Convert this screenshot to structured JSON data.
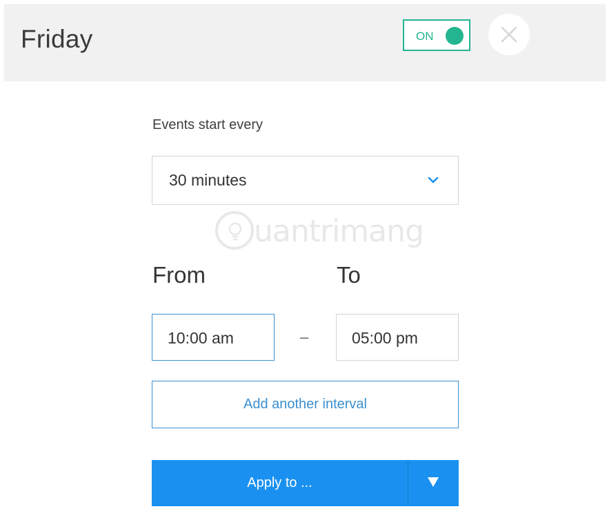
{
  "header": {
    "title": "Friday",
    "toggle": {
      "label": "ON",
      "state": "on",
      "color": "#23b58f"
    },
    "close_icon": "close-icon"
  },
  "schedule": {
    "events_label": "Events start every",
    "interval": {
      "value": "30 minutes",
      "icon": "chevron-down-icon"
    },
    "from_label": "From",
    "to_label": "To",
    "from_time": "10:00 am",
    "separator": "–",
    "to_time": "05:00 pm",
    "add_interval_label": "Add another interval"
  },
  "apply": {
    "label": "Apply to ...",
    "dropdown_icon": "triangle-down-icon",
    "color": "#1a91f0"
  },
  "watermark": {
    "text": "uantrimang",
    "icon": "lightbulb-icon"
  },
  "colors": {
    "accent_blue": "#3b8fcf",
    "on_green": "#23b58f",
    "header_bg": "#f1f1f1"
  }
}
